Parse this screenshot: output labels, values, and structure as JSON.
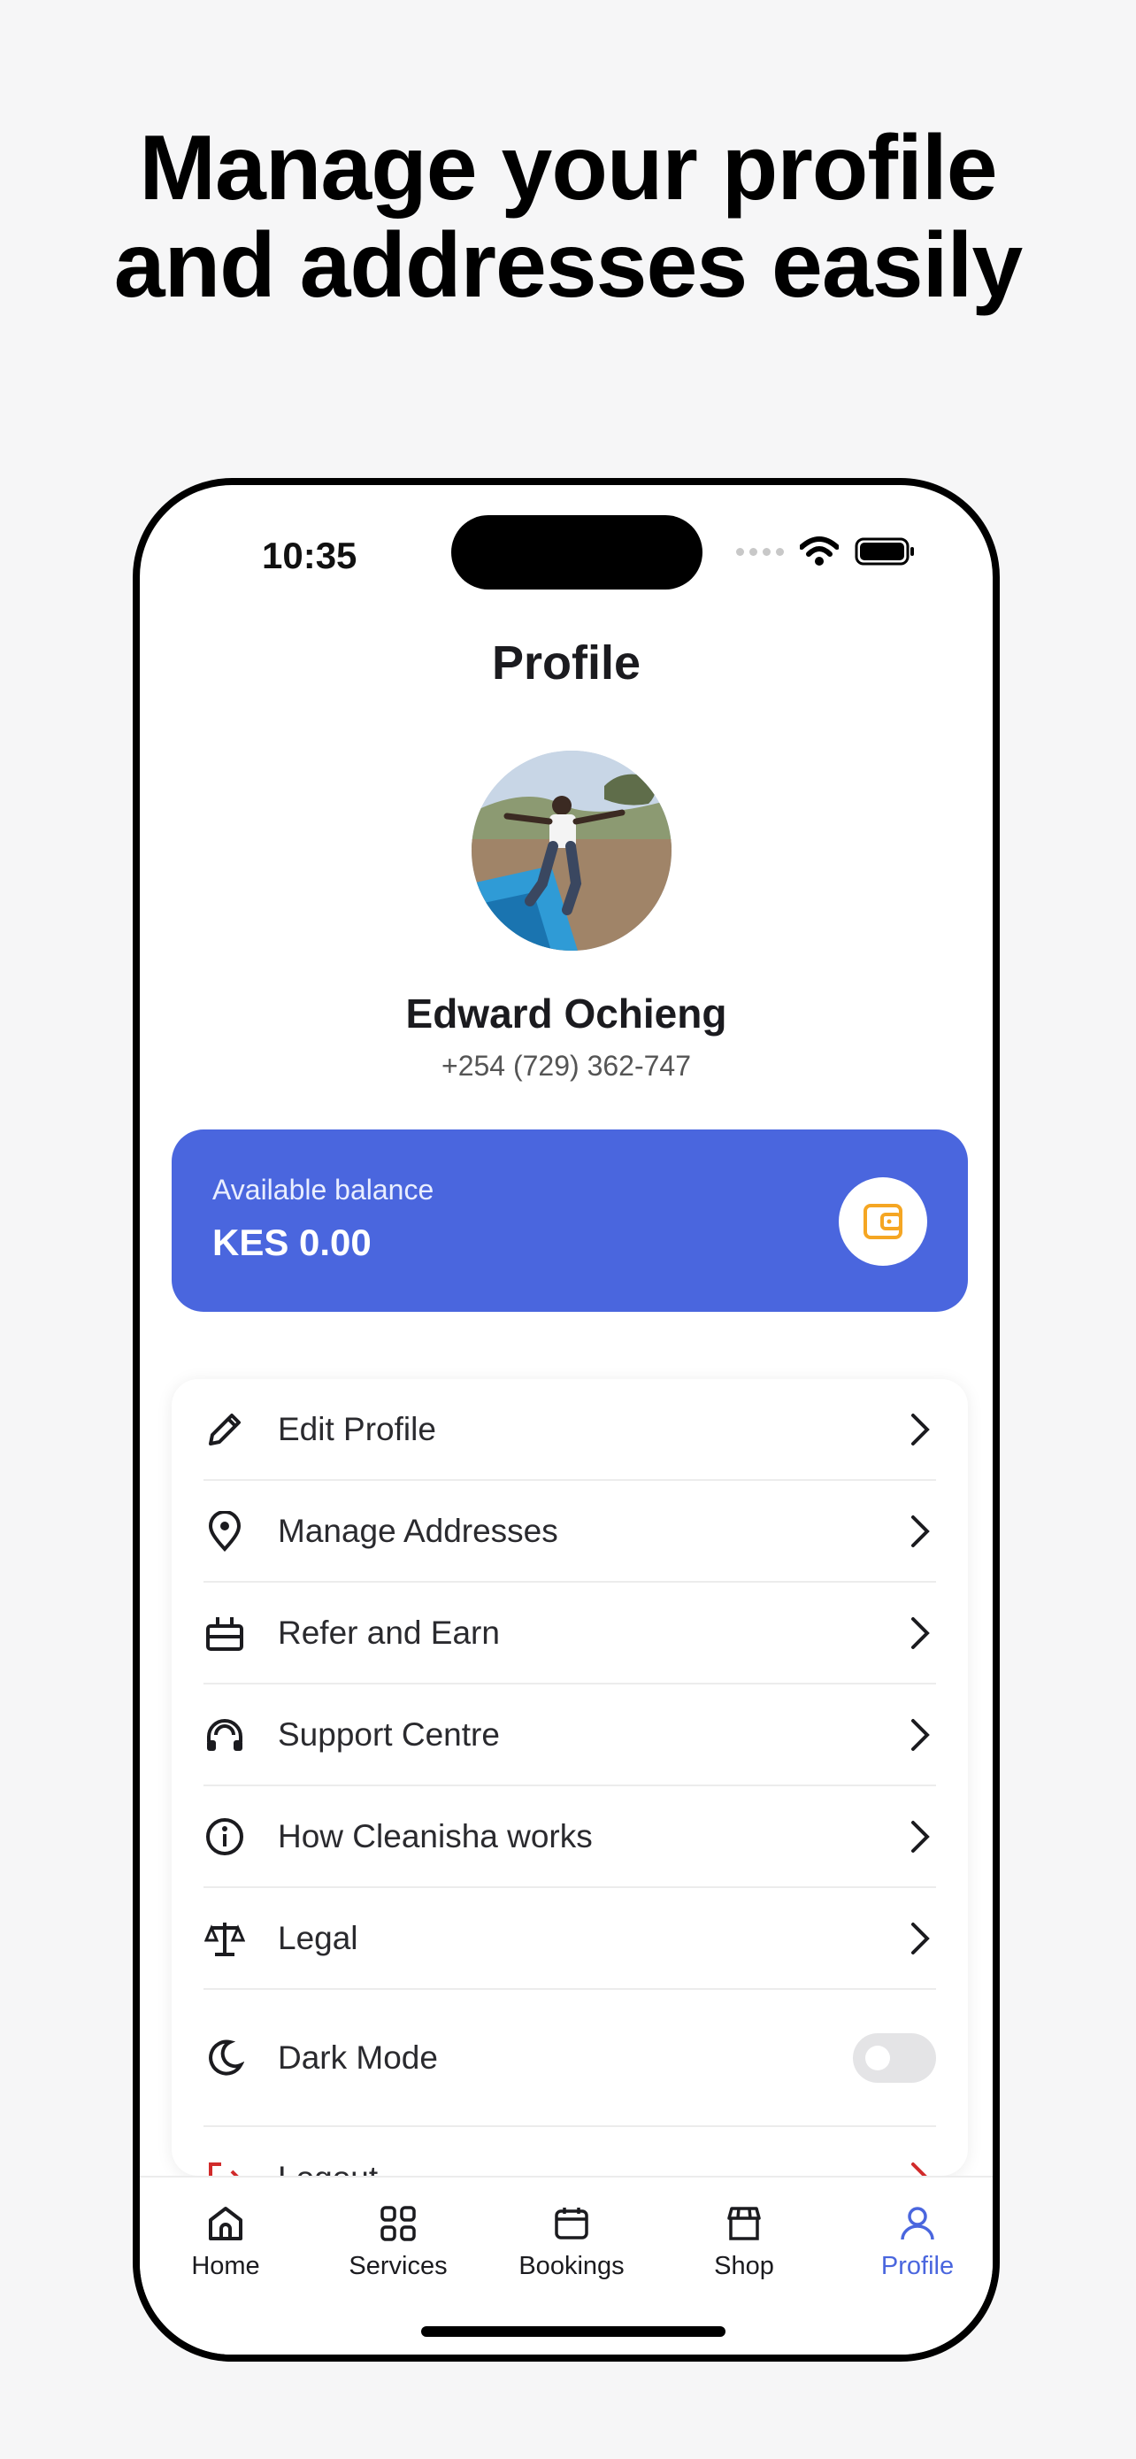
{
  "headline": {
    "line1": "Manage your profile",
    "line2": "and addresses easily"
  },
  "status_bar": {
    "time": "10:35"
  },
  "screen": {
    "title": "Profile"
  },
  "user": {
    "name": "Edward Ochieng",
    "phone": "+254 (729) 362-747"
  },
  "balance": {
    "label": "Available balance",
    "value": "KES 0.00"
  },
  "menu": [
    {
      "label": "Edit Profile",
      "icon": "pencil-icon"
    },
    {
      "label": "Manage Addresses",
      "icon": "location-pin-icon"
    },
    {
      "label": "Refer and Earn",
      "icon": "gift-icon"
    },
    {
      "label": "Support Centre",
      "icon": "headset-icon"
    },
    {
      "label": "How Cleanisha works",
      "icon": "info-icon"
    },
    {
      "label": "Legal",
      "icon": "scale-icon"
    }
  ],
  "dark_mode": {
    "label": "Dark Mode",
    "enabled": false
  },
  "logout": {
    "label": "Logout"
  },
  "tabs": [
    {
      "label": "Home",
      "icon": "home-icon",
      "active": false
    },
    {
      "label": "Services",
      "icon": "grid-icon",
      "active": false
    },
    {
      "label": "Bookings",
      "icon": "calendar-icon",
      "active": false
    },
    {
      "label": "Shop",
      "icon": "store-icon",
      "active": false
    },
    {
      "label": "Profile",
      "icon": "user-icon",
      "active": true
    }
  ],
  "colors": {
    "accent": "#4a66de",
    "wallet_icon": "#f5a623",
    "logout": "#d12b2b"
  }
}
